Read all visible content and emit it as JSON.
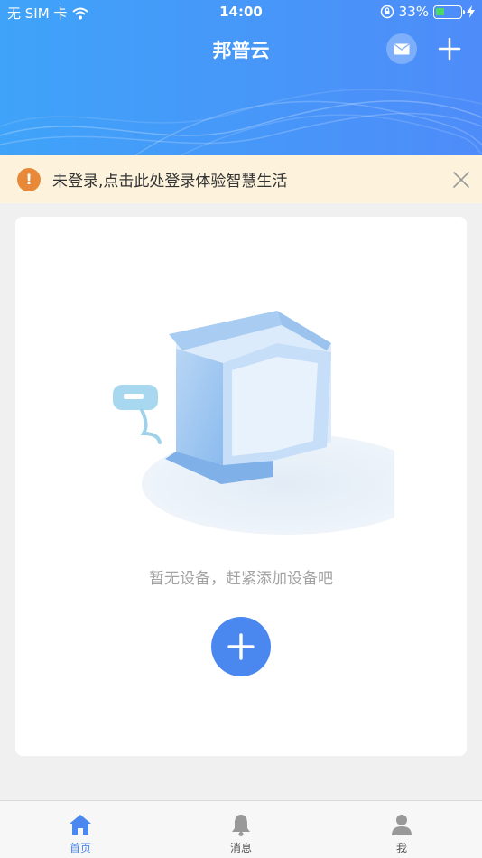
{
  "status_bar": {
    "carrier": "无 SIM 卡",
    "time": "14:00",
    "battery_percent": "33%",
    "battery_level": 0.33
  },
  "header": {
    "title": "邦普云",
    "icons": [
      "mail-icon",
      "plus-icon"
    ]
  },
  "banner": {
    "icon_text": "!",
    "text": "未登录,点击此处登录体验智慧生活"
  },
  "empty_state": {
    "text": "暂无设备，赶紧添加设备吧"
  },
  "tabs": [
    {
      "label": "首页",
      "icon": "home-icon",
      "active": true
    },
    {
      "label": "消息",
      "icon": "bell-icon",
      "active": false
    },
    {
      "label": "我",
      "icon": "user-icon",
      "active": false
    }
  ],
  "colors": {
    "header_start": "#3fa3f9",
    "header_end": "#4e8cf9",
    "accent": "#4a88ef",
    "banner_bg": "#fdf3dc",
    "warning": "#e8893a"
  }
}
